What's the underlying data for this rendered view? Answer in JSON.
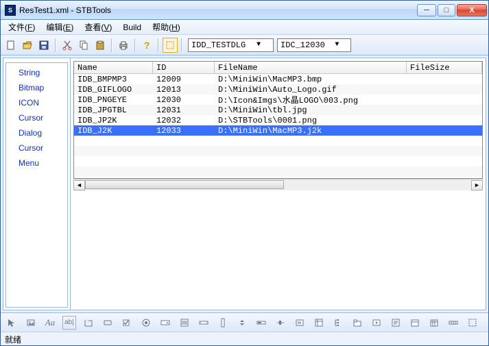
{
  "window": {
    "title": "ResTest1.xml - STBTools"
  },
  "menubar": [
    {
      "label": "文件",
      "accel": "F"
    },
    {
      "label": "编辑",
      "accel": "E"
    },
    {
      "label": "查看",
      "accel": "V"
    },
    {
      "label": "Build",
      "accel": ""
    },
    {
      "label": "帮助",
      "accel": "H"
    }
  ],
  "toolbar": {
    "combo1": "IDD_TESTDLG",
    "combo2": "IDC_12030"
  },
  "sidebar": {
    "items": [
      "String",
      "Bitmap",
      "ICON",
      "Cursor",
      "Dialog",
      "Cursor",
      "Menu"
    ]
  },
  "list": {
    "headers": {
      "name": "Name",
      "id": "ID",
      "file": "FileName",
      "size": "FileSize"
    },
    "rows": [
      {
        "name": "IDB_BMPMP3",
        "id": "12009",
        "file": "D:\\MiniWin\\MacMP3.bmp",
        "size": "",
        "selected": false
      },
      {
        "name": "IDB_GIFLOGO",
        "id": "12013",
        "file": "D:\\MiniWin\\Auto_Logo.gif",
        "size": "",
        "selected": false
      },
      {
        "name": "IDB_PNGEYE",
        "id": "12030",
        "file": "D:\\Icon&Imgs\\水晶LOGO\\003.png",
        "size": "",
        "selected": false
      },
      {
        "name": "IDB_JPGTBL",
        "id": "12031",
        "file": "D:\\MiniWin\\tbl.jpg",
        "size": "",
        "selected": false
      },
      {
        "name": "IDB_JP2K",
        "id": "12032",
        "file": "D:\\STBTools\\0001.png",
        "size": "",
        "selected": false
      },
      {
        "name": "IDB_J2K",
        "id": "12033",
        "file": "D:\\MiniWin\\MacMP3.j2k",
        "size": "",
        "selected": true
      }
    ]
  },
  "status": "就绪",
  "icons": {
    "min": "─",
    "max": "□",
    "close": "X",
    "dropdown": "▼",
    "left": "◄",
    "right": "►",
    "new": "□",
    "open": "📂",
    "save": "💾",
    "cut": "✂",
    "copy": "⧉",
    "paste": "📋",
    "print": "⎙",
    "help": "?",
    "sel": "▭"
  }
}
